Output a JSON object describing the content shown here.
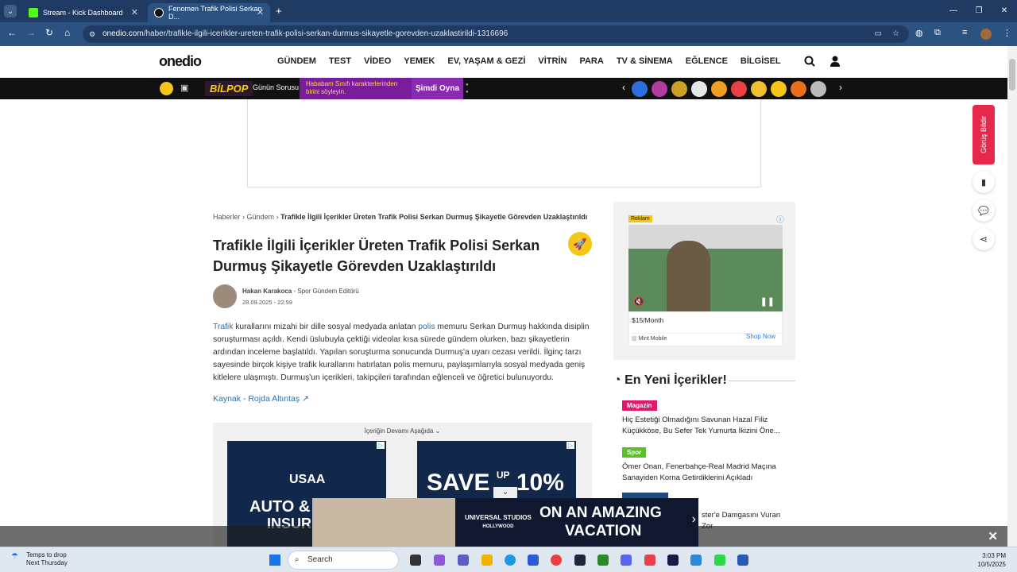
{
  "browser": {
    "tabs": [
      {
        "title": "Stream - Kick Dashboard"
      },
      {
        "title": "Fenomen Trafik Polisi Serkan D..."
      }
    ],
    "url_host": "onedio.com",
    "url_path": "/haber/trafikle-ilgili-icerikler-ureten-trafik-polisi-serkan-durmus-sikayetle-gorevden-uzaklastirildi-1316696"
  },
  "header": {
    "logo": "onedio",
    "nav": [
      "GÜNDEM",
      "TEST",
      "VİDEO",
      "YEMEK",
      "EV, YAŞAM & GEZİ",
      "VİTRİN",
      "PARA",
      "TV & SİNEMA",
      "EĞLENCE",
      "BİLGİSEL"
    ]
  },
  "promo": {
    "brand": "BİLPOP",
    "label": "Günün Sorusu",
    "question": "Hababam Sınıfı karakterlerinden birini söyleyin.",
    "play": "Şimdi Oyna"
  },
  "feedback": "Görüş Bildir",
  "breadcrumb": {
    "home": "Haberler",
    "cat": "Gündem",
    "current": "Trafikle İlgili İçerikler Üreten Trafik Polisi Serkan Durmuş Şikayetle Görevden Uzaklaştırıldı"
  },
  "article": {
    "title": "Trafikle İlgili İçerikler Üreten Trafik Polisi Serkan Durmuş Şikayetle Görevden Uzaklaştırıldı",
    "author": "Hakan Karakoca",
    "author_role": " - Spor Gündem Editörü",
    "date": "28.09.2025 - 22:59",
    "link1": "Trafik",
    "text1": " kurallarını mizahi bir dille sosyal medyada anlatan ",
    "link2": "polis",
    "text2": " memuru Serkan Durmuş hakkında disiplin soruşturması açıldı. Kendi üslubuyla çektiği videolar kısa sürede gündem olurken, bazı şikayetlerin ardından inceleme başlatıldı. Yapılan soruşturma sonucunda Durmuş'a uyarı cezası verildi. İlginç tarzı sayesinde birçok kişiye trafik kurallarını hatırlatan polis memuru, paylaşımlarıyla sosyal medyada geniş kitlelere ulaşmıştı. Durmuş'un içerikleri, takipçileri tarafından eğlenceli ve öğretici bulunuyordu.",
    "source": "Kaynak - Rojda Altıntaş",
    "continue": "İçeriğin Devamı Aşağıda"
  },
  "ads": {
    "usaa_logo": "USAA",
    "usaa_text": "AUTO & R",
    "usaa_text2": "INSUR",
    "save_text": "SAVE",
    "save_up": "UP",
    "save_pct": "10%",
    "sidebar_reklam": "Reklam",
    "sidebar_price": "$15/Month",
    "sidebar_brand": "Mint Mobile",
    "sidebar_shop": "Shop Now",
    "sticky_brand": "UNIVERSAL STUDIOS",
    "sticky_sub": "HOLLYWOOD",
    "sticky_text1": "ON AN AMAZING",
    "sticky_text2": "VACATION"
  },
  "sidebar": {
    "heading": "En Yeni İçerikler!",
    "items": [
      {
        "category": "Magazin",
        "color": "#e0196f",
        "title": "Hiç Estetiği Olmadığını Savunan Hazal Filiz Küçükköse, Bu Sefer Tek Yumurta İkizini Öne..."
      },
      {
        "category": "Spor",
        "color": "#5cbf2a",
        "title": "Ömer Onan, Fenerbahçe-Real Madrid Maçına Sanayiden Korna Getirdiklerini Açıkladı"
      },
      {
        "category": "",
        "color": "#1f4a7a",
        "title": "ster'e Damgasını Vuran Zor"
      }
    ]
  },
  "taskbar": {
    "weather_title": "Temps to drop",
    "weather_sub": "Next Thursday",
    "search": "Search",
    "time": "3:03 PM",
    "date": "10/5/2025"
  }
}
